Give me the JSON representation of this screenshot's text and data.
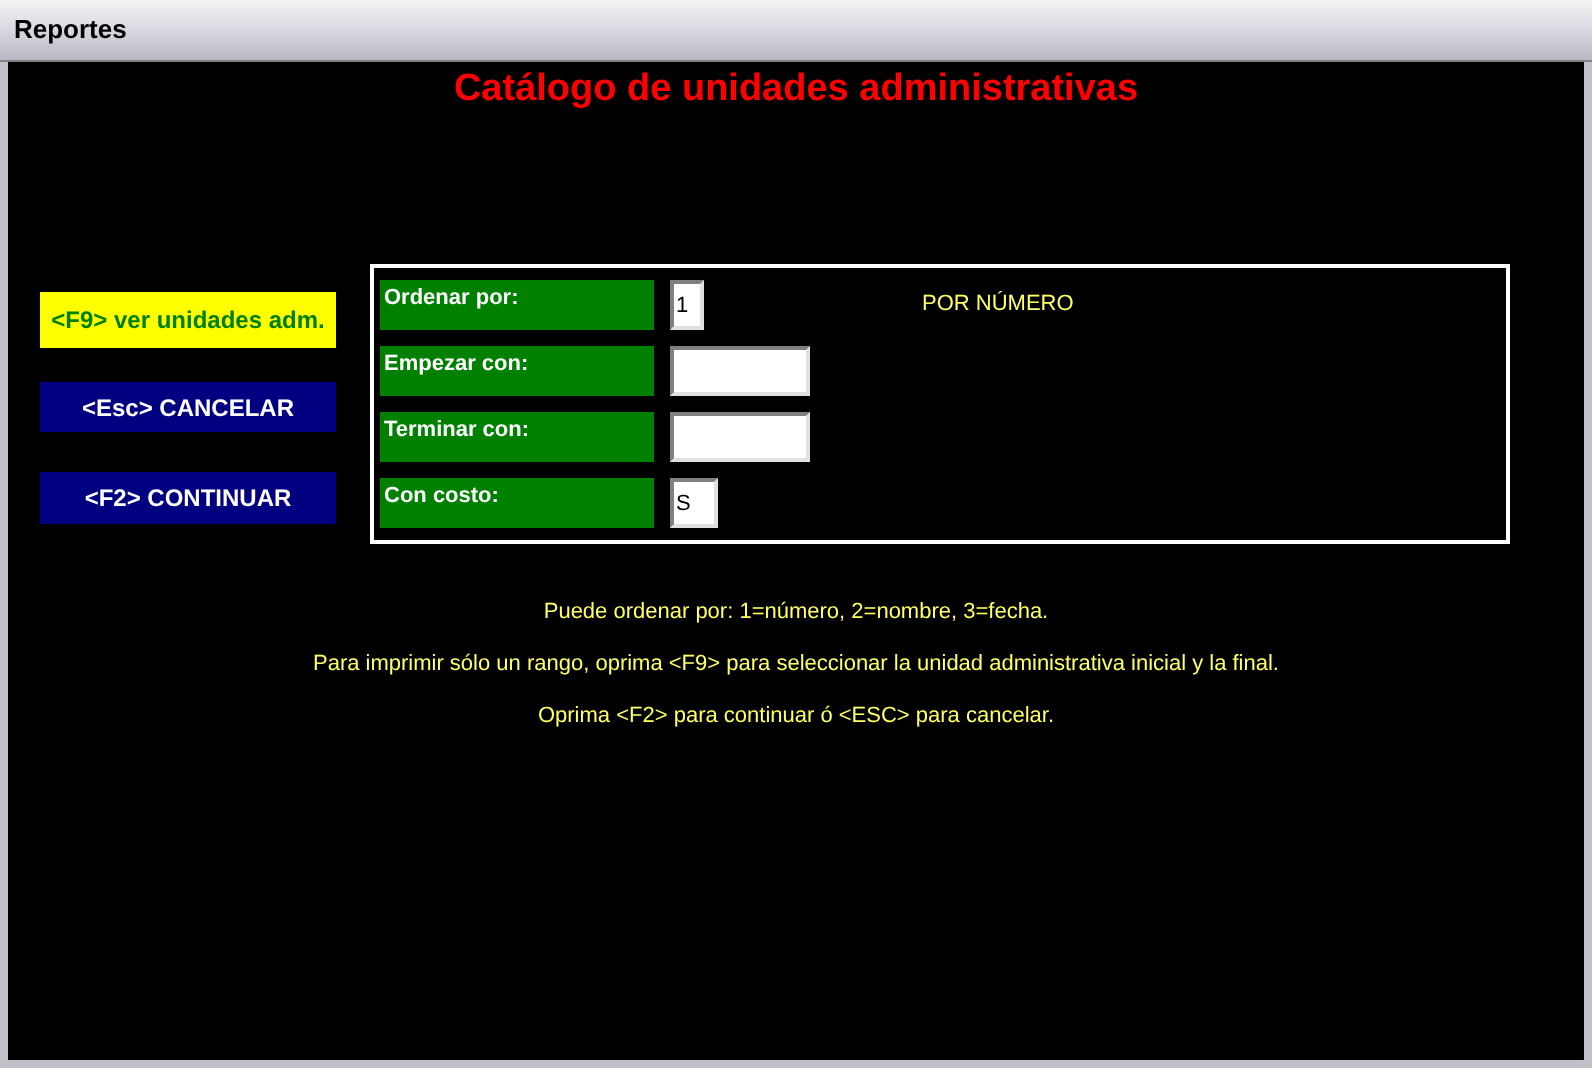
{
  "window": {
    "title": "Reportes"
  },
  "heading": "Catálogo de unidades administrativas",
  "buttons": [
    {
      "label": "<F9> ver unidades adm.",
      "selected": true
    },
    {
      "label": "<Esc> CANCELAR",
      "selected": false
    },
    {
      "label": "<F2> CONTINUAR",
      "selected": false
    }
  ],
  "fields": [
    {
      "label": "Ordenar por:",
      "value": "1",
      "note": "POR NÚMERO"
    },
    {
      "label": "Empezar con:"
    },
    {
      "label": "Terminar con:"
    },
    {
      "label": "Con costo:",
      "value": "S"
    }
  ],
  "help": [
    "Puede ordenar por: 1=número, 2=nombre, 3=fecha.",
    "Para imprimir sólo un rango, oprima <F9> para seleccionar la unidad administrativa inicial y la final.",
    "Oprima <F2> para continuar ó <ESC> para cancelar."
  ]
}
